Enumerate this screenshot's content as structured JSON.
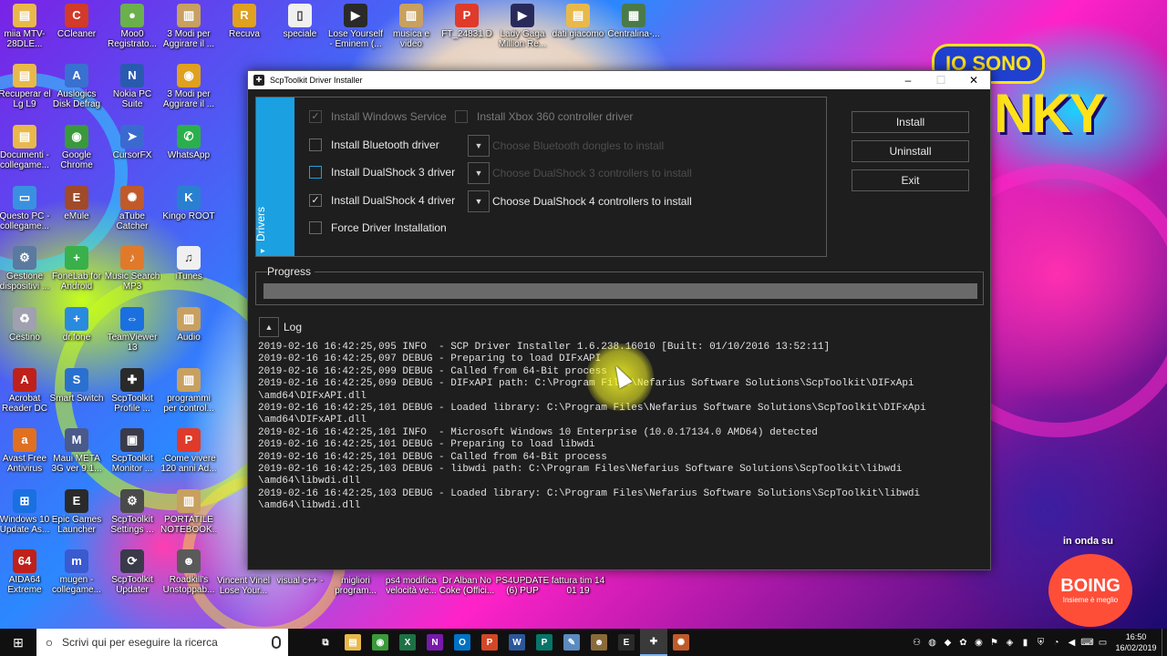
{
  "desktop": {
    "icons": [
      {
        "label": "miia MTV-28DLE...",
        "icon": "folder-icon",
        "color": "#e8b94a",
        "glyph": "▤"
      },
      {
        "label": "CCleaner",
        "icon": "ccleaner-icon",
        "color": "#d23a2a",
        "glyph": "C"
      },
      {
        "label": "Moo0 Registrato...",
        "icon": "moo0-icon",
        "color": "#6ab04c",
        "glyph": "●"
      },
      {
        "label": "3 Modi per Aggirare il ...",
        "icon": "archive-icon",
        "color": "#c8a060",
        "glyph": "▥"
      },
      {
        "label": "Recuva",
        "icon": "recuva-icon",
        "color": "#e0a020",
        "glyph": "R"
      },
      {
        "label": "speciale",
        "icon": "document-icon",
        "color": "#f0f0f0",
        "glyph": "▯"
      },
      {
        "label": "Lose Yourself - Eminem (...",
        "icon": "video-icon",
        "color": "#2a2a2a",
        "glyph": "▶"
      },
      {
        "label": "musica e video",
        "icon": "archive-icon",
        "color": "#c8a060",
        "glyph": "▥"
      },
      {
        "label": "FT_24831.D",
        "icon": "pdf-icon",
        "color": "#e03a2a",
        "glyph": "P"
      },
      {
        "label": "Lady Gaga Million Re...",
        "icon": "video-icon",
        "color": "#2a2a5a",
        "glyph": "▶"
      },
      {
        "label": "dati giacomo",
        "icon": "folder-icon",
        "color": "#e8b94a",
        "glyph": "▤"
      },
      {
        "label": "Centralina-...",
        "icon": "image-icon",
        "color": "#4a7a4a",
        "glyph": "▦"
      },
      {
        "label": "Recuperar el Lg L9",
        "icon": "folder-icon",
        "color": "#e8b94a",
        "glyph": "▤"
      },
      {
        "label": "Auslogics Disk Defrag",
        "icon": "auslogics-icon",
        "color": "#3a70d0",
        "glyph": "A"
      },
      {
        "label": "Nokia PC Suite",
        "icon": "nokia-icon",
        "color": "#2a5ab0",
        "glyph": "N"
      },
      {
        "label": "3 Modi per Aggirare il ...",
        "icon": "chrome-icon",
        "color": "#e0a020",
        "glyph": "◉"
      },
      {
        "label": "Documenti - collegame...",
        "icon": "documents-icon",
        "color": "#e8b94a",
        "glyph": "▤"
      },
      {
        "label": "Google Chrome",
        "icon": "chrome-icon",
        "color": "#3a9a3a",
        "glyph": "◉"
      },
      {
        "label": "CursorFX",
        "icon": "cursorfx-icon",
        "color": "#3a6ad0",
        "glyph": "➤"
      },
      {
        "label": "WhatsApp",
        "icon": "whatsapp-icon",
        "color": "#2ab04a",
        "glyph": "✆"
      },
      {
        "label": "Questo PC - collegame...",
        "icon": "computer-icon",
        "color": "#3a90e0",
        "glyph": "▭"
      },
      {
        "label": "eMule",
        "icon": "emule-icon",
        "color": "#a04a2a",
        "glyph": "E"
      },
      {
        "label": "aTube Catcher",
        "icon": "atube-icon",
        "color": "#c05a2a",
        "glyph": "✺"
      },
      {
        "label": "Kingo ROOT",
        "icon": "kingo-icon",
        "color": "#2a80d0",
        "glyph": "K"
      },
      {
        "label": "Gestione dispositivi ...",
        "icon": "device-manager-icon",
        "color": "#5a7aa0",
        "glyph": "⚙"
      },
      {
        "label": "FoneLab for Android",
        "icon": "fonelab-icon",
        "color": "#3ab04a",
        "glyph": "+"
      },
      {
        "label": "Music Search MP3",
        "icon": "music-icon",
        "color": "#e07a2a",
        "glyph": "♪"
      },
      {
        "label": "iTunes",
        "icon": "itunes-icon",
        "color": "#f0f0f0",
        "glyph": "♫"
      },
      {
        "label": "Cestino",
        "icon": "recycle-bin-icon",
        "color": "#a0a0b0",
        "glyph": "♻"
      },
      {
        "label": "dr.fone",
        "icon": "drfone-icon",
        "color": "#2a8ae0",
        "glyph": "+"
      },
      {
        "label": "TeamViewer 13",
        "icon": "teamviewer-icon",
        "color": "#1a70e0",
        "glyph": "⇔"
      },
      {
        "label": "Audio",
        "icon": "archive-icon",
        "color": "#c8a060",
        "glyph": "▥"
      },
      {
        "label": "Acrobat Reader DC",
        "icon": "acrobat-icon",
        "color": "#c0201a",
        "glyph": "A"
      },
      {
        "label": "Smart Switch",
        "icon": "smart-switch-icon",
        "color": "#2a70d0",
        "glyph": "S"
      },
      {
        "label": "ScpToolkit Profile ...",
        "icon": "gamepad-icon",
        "color": "#2a2a2a",
        "glyph": "✚"
      },
      {
        "label": "programmi per control...",
        "icon": "archive-icon",
        "color": "#c8a060",
        "glyph": "▥"
      },
      {
        "label": "Avast Free Antivirus",
        "icon": "avast-icon",
        "color": "#e07020",
        "glyph": "a"
      },
      {
        "label": "Maui META 3G ver 9.1...",
        "icon": "meta-icon",
        "color": "#4a5a8a",
        "glyph": "M"
      },
      {
        "label": "ScpToolkit Monitor ...",
        "icon": "monitor-icon",
        "color": "#3a3a4a",
        "glyph": "▣"
      },
      {
        "label": "-Come vivere 120 anni Ad...",
        "icon": "pdf-icon",
        "color": "#e03a2a",
        "glyph": "P"
      },
      {
        "label": "Windows 10 Update As...",
        "icon": "windows-icon",
        "color": "#1a70e0",
        "glyph": "⊞"
      },
      {
        "label": "Epic Games Launcher",
        "icon": "epic-icon",
        "color": "#2a2a2a",
        "glyph": "E"
      },
      {
        "label": "ScpToolkit Settings ...",
        "icon": "settings-icon",
        "color": "#4a4a4a",
        "glyph": "⚙"
      },
      {
        "label": "PORTATILE NOTEBOOK...",
        "icon": "archive-icon",
        "color": "#c8a060",
        "glyph": "▥"
      },
      {
        "label": "AIDA64 Extreme",
        "icon": "aida-icon",
        "color": "#c0201a",
        "glyph": "64"
      },
      {
        "label": "mugen - collegame...",
        "icon": "mugen-icon",
        "color": "#3a5ad0",
        "glyph": "m"
      },
      {
        "label": "ScpToolkit Updater",
        "icon": "updater-icon",
        "color": "#3a3a4a",
        "glyph": "⟳"
      },
      {
        "label": "Roadkill's Unstoppab...",
        "icon": "roadkill-icon",
        "color": "#5a5a5a",
        "glyph": "☻"
      }
    ],
    "bottom_labels": [
      "Vincent Vinel Lose Your...",
      "visual c++ -",
      "migliori program...",
      "ps4 modifica velocità ve...",
      "Dr Alban No Coke (Offici...",
      "PS4UPDATE (6) PUP",
      "fattura tim 14 01 19"
    ],
    "banner_top": "IO SONO",
    "banner_big": "NKY",
    "onda": "in onda su",
    "boing": "BOING",
    "boing_sub": "Insieme è meglio"
  },
  "window": {
    "title": "ScpToolkit Driver Installer",
    "controls": {
      "minimize": "–",
      "maximize": "☐",
      "close": "✕"
    },
    "tab_label": "Drivers",
    "checks": [
      {
        "label": "Install Windows Service",
        "checked": true,
        "disabled": true
      },
      {
        "label": "Install Bluetooth driver",
        "checked": false,
        "disabled": false
      },
      {
        "label": "Install DualShock 3 driver",
        "checked": false,
        "disabled": false
      },
      {
        "label": "Install DualShock 4 driver",
        "checked": true,
        "disabled": false
      },
      {
        "label": "Force Driver Installation",
        "checked": false,
        "disabled": false
      }
    ],
    "xbox_check": {
      "label": "Install Xbox 360 controller driver",
      "checked": false,
      "disabled": true
    },
    "dropdowns": [
      {
        "label": "Choose Bluetooth dongles to install",
        "disabled": true
      },
      {
        "label": "Choose DualShock 3 controllers to install",
        "disabled": true
      },
      {
        "label": "Choose DualShock 4 controllers to install",
        "disabled": false
      }
    ],
    "buttons": {
      "install": "Install",
      "uninstall": "Uninstall",
      "exit": "Exit"
    },
    "progress_label": "Progress",
    "progress_value": 0,
    "log_label": "Log",
    "log_lines": [
      "2019-02-16 16:42:25,095 INFO  - SCP Driver Installer 1.6.238.16010 [Built: 01/10/2016 13:52:11]",
      "2019-02-16 16:42:25,097 DEBUG - Preparing to load DIFxAPI",
      "2019-02-16 16:42:25,099 DEBUG - Called from 64-Bit process",
      "2019-02-16 16:42:25,099 DEBUG - DIFxAPI path: C:\\Program Files\\Nefarius Software Solutions\\ScpToolkit\\DIFxApi",
      "\\amd64\\DIFxAPI.dll",
      "2019-02-16 16:42:25,101 DEBUG - Loaded library: C:\\Program Files\\Nefarius Software Solutions\\ScpToolkit\\DIFxApi",
      "\\amd64\\DIFxAPI.dll",
      "2019-02-16 16:42:25,101 INFO  - Microsoft Windows 10 Enterprise (10.0.17134.0 AMD64) detected",
      "2019-02-16 16:42:25,101 DEBUG - Preparing to load libwdi",
      "2019-02-16 16:42:25,101 DEBUG - Called from 64-Bit process",
      "2019-02-16 16:42:25,103 DEBUG - libwdi path: C:\\Program Files\\Nefarius Software Solutions\\ScpToolkit\\libwdi",
      "\\amd64\\libwdi.dll",
      "2019-02-16 16:42:25,103 DEBUG - Loaded library: C:\\Program Files\\Nefarius Software Solutions\\ScpToolkit\\libwdi",
      "\\amd64\\libwdi.dll"
    ],
    "accent": "#1ba1e2"
  },
  "taskbar": {
    "search_placeholder": "Scrivi qui per eseguire la ricerca",
    "apps": [
      {
        "name": "task-view-icon",
        "glyph": "⧉",
        "color": "#101010"
      },
      {
        "name": "file-explorer-icon",
        "glyph": "▤",
        "color": "#e8b94a"
      },
      {
        "name": "chrome-icon",
        "glyph": "◉",
        "color": "#3a9a3a"
      },
      {
        "name": "excel-icon",
        "glyph": "X",
        "color": "#1e7145"
      },
      {
        "name": "onenote-icon",
        "glyph": "N",
        "color": "#7719aa"
      },
      {
        "name": "outlook-icon",
        "glyph": "O",
        "color": "#0072c6"
      },
      {
        "name": "powerpoint-icon",
        "glyph": "P",
        "color": "#d24726"
      },
      {
        "name": "word-icon",
        "glyph": "W",
        "color": "#2b579a"
      },
      {
        "name": "publisher-icon",
        "glyph": "P",
        "color": "#077568"
      },
      {
        "name": "notepad-icon",
        "glyph": "✎",
        "color": "#5a8ac0"
      },
      {
        "name": "gimp-icon",
        "glyph": "☻",
        "color": "#8a6a3a"
      },
      {
        "name": "epic-games-icon",
        "glyph": "E",
        "color": "#2a2a2a"
      },
      {
        "name": "scptoolkit-icon",
        "glyph": "✚",
        "color": "#3a3a3a"
      },
      {
        "name": "atube-icon",
        "glyph": "✺",
        "color": "#c05a2a"
      }
    ],
    "tray": [
      {
        "name": "people-icon",
        "glyph": "⚇"
      },
      {
        "name": "firefox-icon",
        "glyph": "◍"
      },
      {
        "name": "tray-app-icon",
        "glyph": "◆"
      },
      {
        "name": "tray-app-icon",
        "glyph": "✿"
      },
      {
        "name": "tray-app-icon",
        "glyph": "◉"
      },
      {
        "name": "tray-app-icon",
        "glyph": "⚑"
      },
      {
        "name": "tray-app-icon",
        "glyph": "◈"
      },
      {
        "name": "battery-icon",
        "glyph": "▮"
      },
      {
        "name": "shield-icon",
        "glyph": "⛨"
      },
      {
        "name": "network-icon",
        "glyph": "◔"
      },
      {
        "name": "volume-icon",
        "glyph": "◀"
      },
      {
        "name": "keyboard-icon",
        "glyph": "⌨"
      },
      {
        "name": "notification-icon",
        "glyph": "▭"
      }
    ],
    "time": "16:50",
    "date": "16/02/2019"
  }
}
